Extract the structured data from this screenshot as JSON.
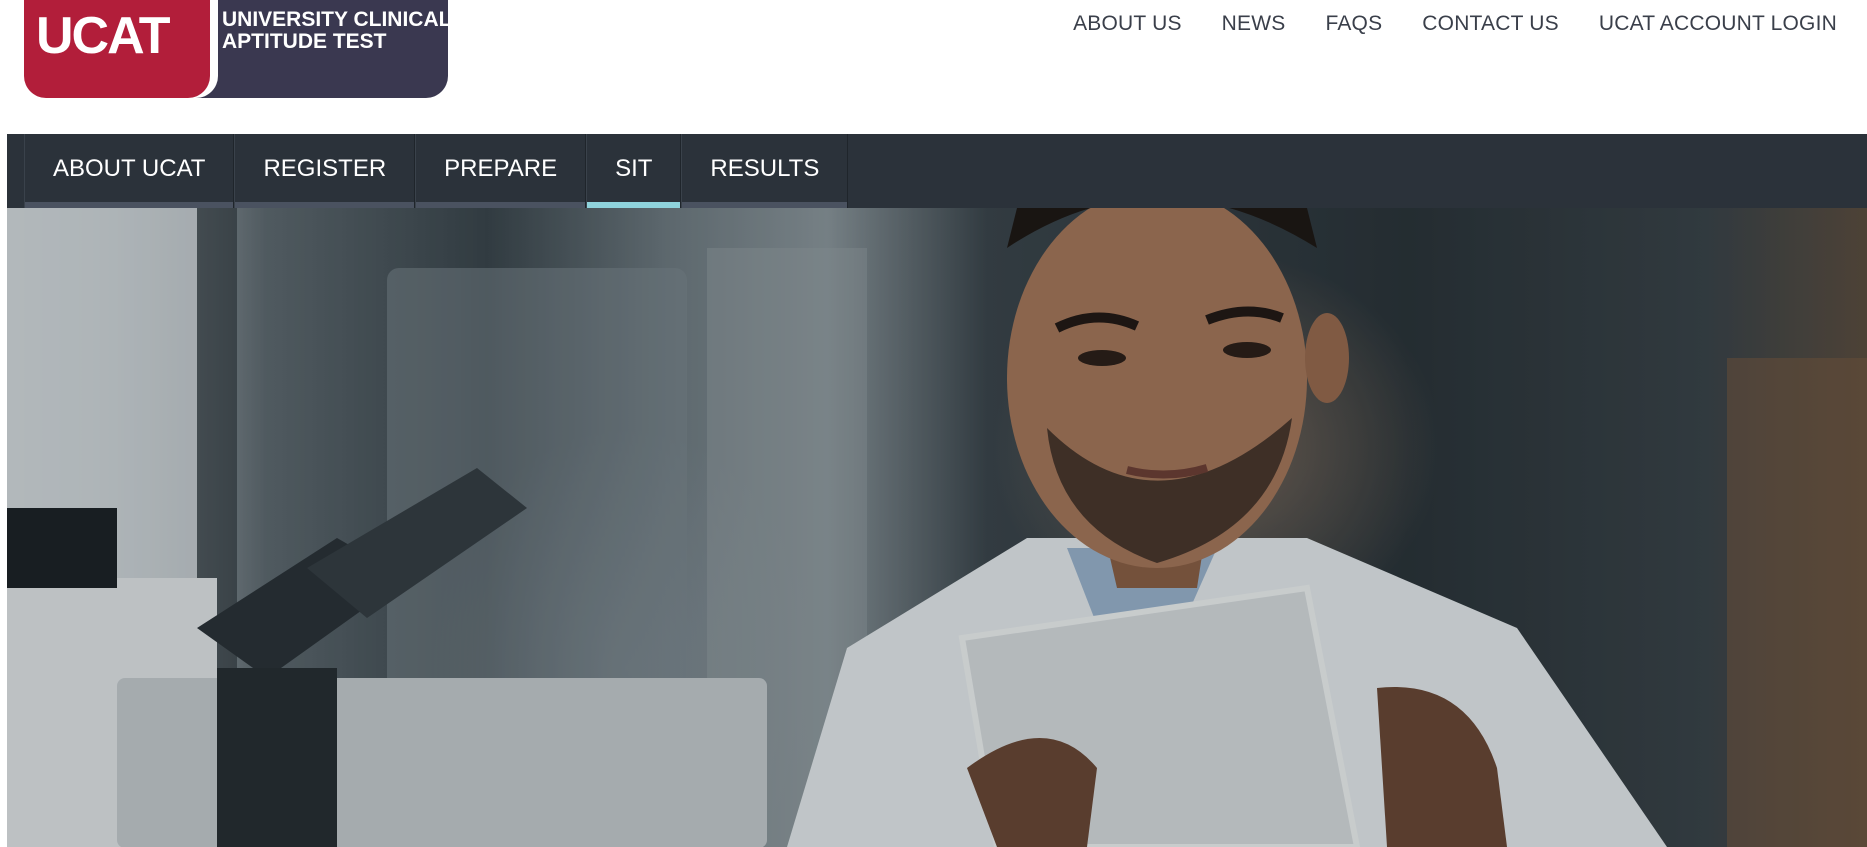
{
  "logo": {
    "mark": "UCAT",
    "name_line1": "UNIVERSITY CLINICAL",
    "name_line2": "APTITUDE TEST",
    "colors": {
      "mark": "#b21e3a",
      "text_panel": "#3a3850"
    }
  },
  "utility_nav": {
    "items": [
      {
        "label": "ABOUT US"
      },
      {
        "label": "NEWS"
      },
      {
        "label": "FAQS"
      },
      {
        "label": "CONTACT US"
      },
      {
        "label": "UCAT ACCOUNT LOGIN"
      }
    ]
  },
  "main_nav": {
    "items": [
      {
        "label": "ABOUT UCAT",
        "active": false
      },
      {
        "label": "REGISTER",
        "active": false
      },
      {
        "label": "PREPARE",
        "active": false
      },
      {
        "label": "SIT",
        "active": true
      },
      {
        "label": "RESULTS",
        "active": false
      }
    ],
    "colors": {
      "background": "#2b323a",
      "active_indicator": "#8fd3dc",
      "indicator": "#4a5260"
    }
  },
  "hero": {
    "image": "man-in-lab-coat-reading-tablet-photo"
  }
}
